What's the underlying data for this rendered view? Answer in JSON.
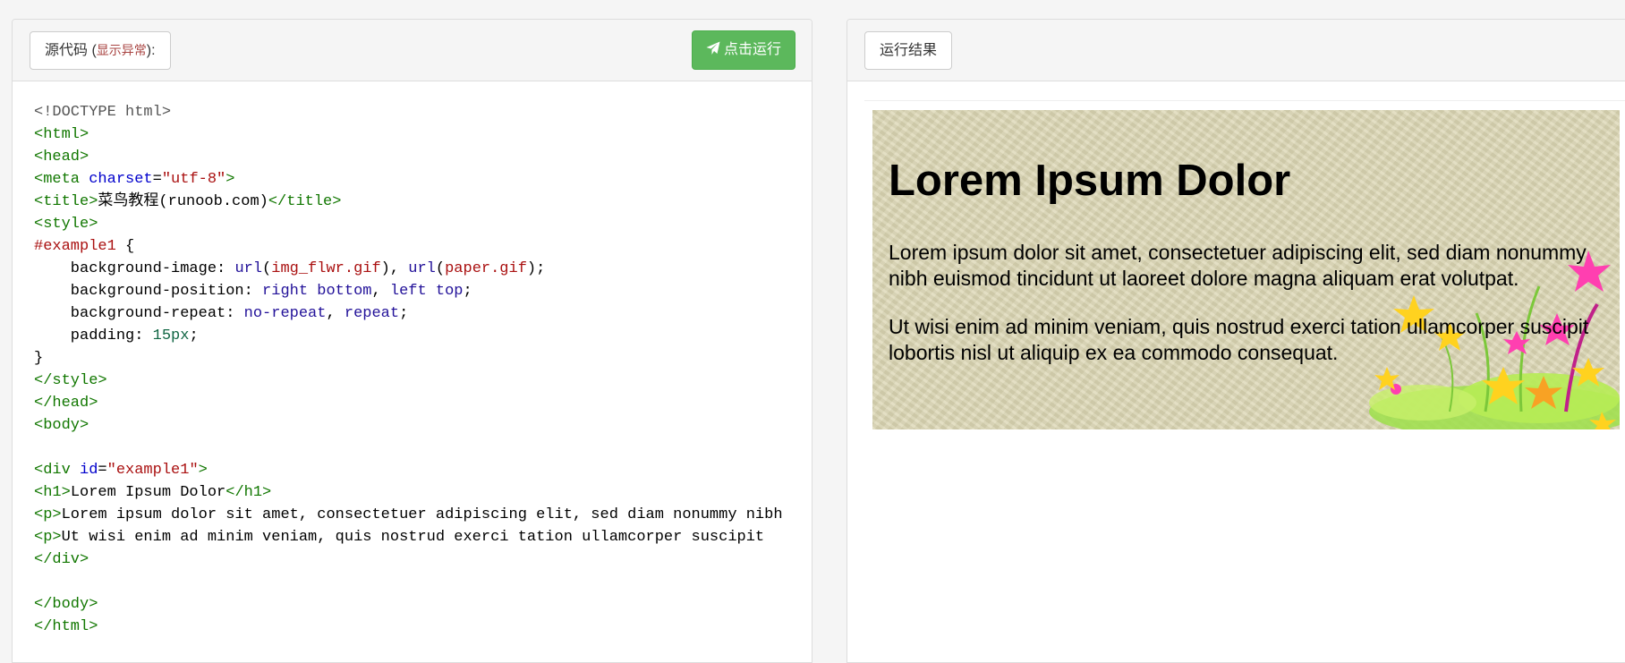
{
  "left": {
    "source_label": "源代码 (",
    "source_hint": "显示异常",
    "source_suffix": "):",
    "run_label": "点击运行",
    "run_icon": "paper-plane-icon"
  },
  "right": {
    "result_label": "运行结果"
  },
  "code_lines": [
    [
      [
        "t-doc",
        "<!DOCTYPE html>"
      ]
    ],
    [
      [
        "t-tag",
        "<html>"
      ]
    ],
    [
      [
        "t-tag",
        "<head>"
      ]
    ],
    [
      [
        "t-tag",
        "<meta "
      ],
      [
        "t-attr",
        "charset"
      ],
      [
        "",
        "="
      ],
      [
        "t-str",
        "\"utf-8\""
      ],
      [
        "t-tag",
        ">"
      ]
    ],
    [
      [
        "t-tag",
        "<title>"
      ],
      [
        "",
        "菜鸟教程(runoob.com)"
      ],
      [
        "t-tag",
        "</title>"
      ]
    ],
    [
      [
        "t-tag",
        "<style>"
      ]
    ],
    [
      [
        "t-sel",
        "#example1"
      ],
      [
        "",
        " {"
      ]
    ],
    [
      [
        "",
        "    background-image: "
      ],
      [
        "t-kw",
        "url"
      ],
      [
        "",
        "("
      ],
      [
        "t-str",
        "img_flwr.gif"
      ],
      [
        "",
        "), "
      ],
      [
        "t-kw",
        "url"
      ],
      [
        "",
        "("
      ],
      [
        "t-str",
        "paper.gif"
      ],
      [
        "",
        ");"
      ]
    ],
    [
      [
        "",
        "    background-position: "
      ],
      [
        "t-kw",
        "right"
      ],
      [
        "",
        " "
      ],
      [
        "t-kw",
        "bottom"
      ],
      [
        "",
        ", "
      ],
      [
        "t-kw",
        "left"
      ],
      [
        "",
        " "
      ],
      [
        "t-kw",
        "top"
      ],
      [
        "",
        ";"
      ]
    ],
    [
      [
        "",
        "    background-repeat: "
      ],
      [
        "t-kw",
        "no-repeat"
      ],
      [
        "",
        ", "
      ],
      [
        "t-kw",
        "repeat"
      ],
      [
        "",
        ";"
      ]
    ],
    [
      [
        "",
        "    padding: "
      ],
      [
        "t-num",
        "15px"
      ],
      [
        "",
        ";"
      ]
    ],
    [
      [
        "",
        "}"
      ]
    ],
    [
      [
        "t-tag",
        "</style>"
      ]
    ],
    [
      [
        "t-tag",
        "</head>"
      ]
    ],
    [
      [
        "t-tag",
        "<body>"
      ]
    ],
    [],
    [
      [
        "t-tag",
        "<div "
      ],
      [
        "t-attr",
        "id"
      ],
      [
        "",
        "="
      ],
      [
        "t-str",
        "\"example1\""
      ],
      [
        "t-tag",
        ">"
      ]
    ],
    [
      [
        "t-tag",
        "<h1>"
      ],
      [
        "",
        "Lorem Ipsum Dolor"
      ],
      [
        "t-tag",
        "</h1>"
      ]
    ],
    [
      [
        "t-tag",
        "<p>"
      ],
      [
        "",
        "Lorem ipsum dolor sit amet, consectetuer adipiscing elit, sed diam nonummy nibh"
      ]
    ],
    [
      [
        "t-tag",
        "<p>"
      ],
      [
        "",
        "Ut wisi enim ad minim veniam, quis nostrud exerci tation ullamcorper suscipit"
      ]
    ],
    [
      [
        "t-tag",
        "</div>"
      ]
    ],
    [],
    [
      [
        "t-tag",
        "</body>"
      ]
    ],
    [
      [
        "t-tag",
        "</html>"
      ]
    ]
  ],
  "preview": {
    "heading": "Lorem Ipsum Dolor",
    "paragraph1": "Lorem ipsum dolor sit amet, consectetuer adipiscing elit, sed diam nonummy nibh euismod tincidunt ut laoreet dolore magna aliquam erat volutpat.",
    "paragraph2": "Ut wisi enim ad minim veniam, quis nostrud exerci tation ullamcorper suscipit lobortis nisl ut aliquip ex ea commodo consequat."
  },
  "colors": {
    "run_button": "#5cb85c",
    "paper": "#dcd7b4"
  }
}
